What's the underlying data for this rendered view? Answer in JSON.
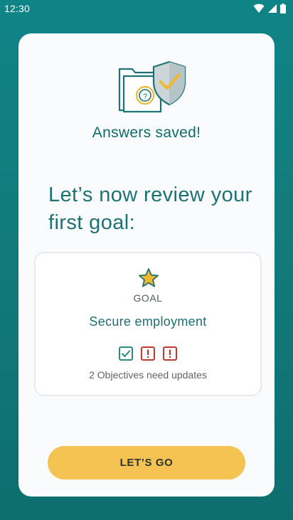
{
  "status_bar": {
    "time": "12:30",
    "icons": [
      "wifi-icon",
      "signal-icon",
      "battery-icon"
    ]
  },
  "card": {
    "illustration": "folder-with-shield-icon",
    "saved_message": "Answers saved!",
    "heading_line1": "Let’s now review your",
    "heading_line2": "first goal:"
  },
  "goal": {
    "icon": "star-icon",
    "label": "GOAL",
    "title": "Secure employment",
    "objectives": [
      {
        "status": "complete",
        "icon": "check-box-icon"
      },
      {
        "status": "needs-update",
        "icon": "alert-box-icon"
      },
      {
        "status": "needs-update",
        "icon": "alert-box-icon"
      }
    ],
    "objectives_text": "2 Objectives need updates"
  },
  "cta": {
    "label": "LET’S GO"
  },
  "colors": {
    "background": "#127c7c",
    "accent_teal": "#1d7276",
    "button_yellow": "#f4c351",
    "check_green": "#2e8a7f",
    "alert_red": "#c0392b"
  }
}
